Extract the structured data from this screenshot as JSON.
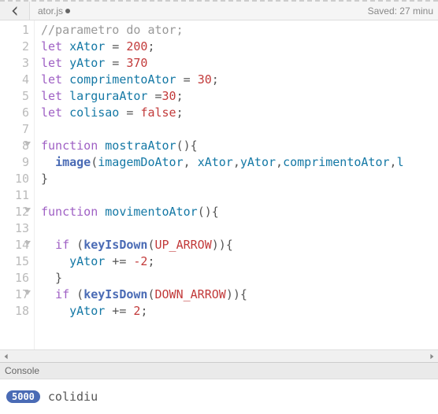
{
  "header": {
    "filename": "ator.js",
    "saved_label": "Saved: 27 minu"
  },
  "code": {
    "lines": [
      {
        "n": "1",
        "fold": false
      },
      {
        "n": "2",
        "fold": false
      },
      {
        "n": "3",
        "fold": false
      },
      {
        "n": "4",
        "fold": false
      },
      {
        "n": "5",
        "fold": false
      },
      {
        "n": "6",
        "fold": false
      },
      {
        "n": "7",
        "fold": false
      },
      {
        "n": "8",
        "fold": true
      },
      {
        "n": "9",
        "fold": false
      },
      {
        "n": "10",
        "fold": false
      },
      {
        "n": "11",
        "fold": false
      },
      {
        "n": "12",
        "fold": true
      },
      {
        "n": "13",
        "fold": false
      },
      {
        "n": "14",
        "fold": true
      },
      {
        "n": "15",
        "fold": false
      },
      {
        "n": "16",
        "fold": false
      },
      {
        "n": "17",
        "fold": true
      },
      {
        "n": "18",
        "fold": false
      }
    ],
    "tokens": {
      "comment1": "//parametro do ator;",
      "let": "let",
      "xAtor": "xAtor",
      "yAtor": "yAtor",
      "comprimentoAtor": "comprimentoAtor",
      "larguraAtor": "larguraAtor",
      "colisao": "colisao",
      "v200": "200",
      "v370": "370",
      "v30": "30",
      "vfalse": "false",
      "function": "function",
      "mostraAtor": "mostraAtor",
      "movimentoAtor": "movimentoAtor",
      "image": "image",
      "imagemDoAtor": "imagemDoAtor",
      "if": "if",
      "keyIsDown": "keyIsDown",
      "UP_ARROW": "UP_ARROW",
      "DOWN_ARROW": "DOWN_ARROW",
      "vneg2": "-2",
      "v2": "2",
      "l_tail": "l"
    }
  },
  "console": {
    "title": "Console",
    "badge": "5000",
    "msg": "colidiu"
  }
}
